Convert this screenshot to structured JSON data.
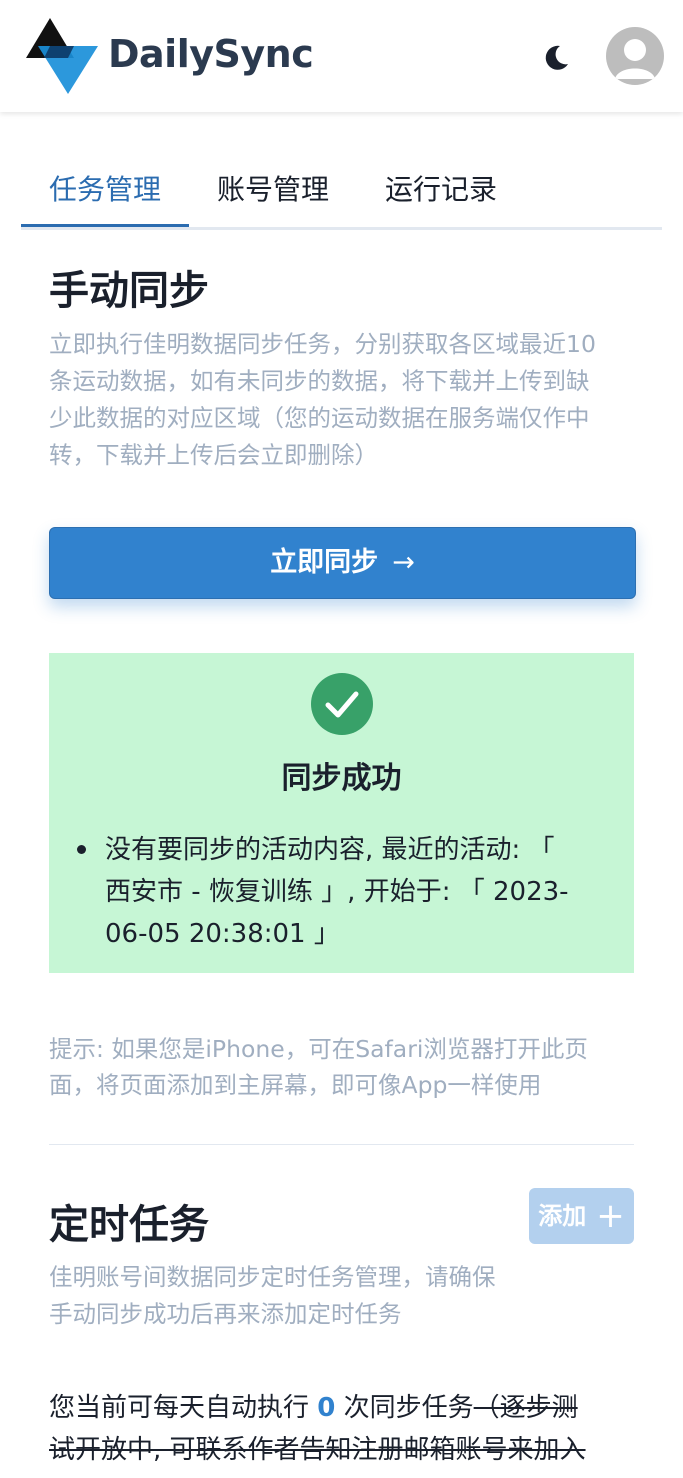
{
  "header": {
    "brand": "DailySync",
    "theme_icon": "moon-icon",
    "avatar_icon": "user-avatar-icon"
  },
  "tabs": [
    {
      "label": "任务管理",
      "active": true
    },
    {
      "label": "账号管理",
      "active": false
    },
    {
      "label": "运行记录",
      "active": false
    }
  ],
  "manual": {
    "title": "手动同步",
    "desc_lines": [
      "立即执行佳明数据同步任务，分别获取各区域最近10",
      "条运动数据，如有未同步的数据，将下载并上传到缺",
      "少此数据的对应区域（您的运动数据在服务端仅作中",
      "转，下载并上传后会立即删除）"
    ],
    "button_label": "立即同步",
    "button_arrow": "→"
  },
  "alert": {
    "title": "同步成功",
    "lines": [
      "没有要同步的活动内容, 最近的活动: 「",
      "西安市 - 恢复训练 」, 开始于: 「 2023-",
      "06-05 20:38:01 」"
    ]
  },
  "tip": {
    "lines": [
      "提示: 如果您是iPhone，可在Safari浏览器打开此页",
      "面，将页面添加到主屏幕，即可像App一样使用"
    ]
  },
  "scheduled": {
    "title": "定时任务",
    "add_label": "添加",
    "add_plus": "+",
    "desc_lines": [
      "佳明账号间数据同步定时任务管理，请确保",
      "手动同步成功后再来添加定时任务"
    ],
    "quota_prefix": "您当前可每天自动执行 ",
    "quota_count": "0",
    "quota_suffix": " 次同步任务",
    "quota_strike_1": "（逐步测",
    "quota_strike_2": "试开放中, 可联系作者告知注册邮箱账号来加入"
  },
  "colors": {
    "accent": "#3182ce",
    "success_bg": "#c6f6d5",
    "success_icon": "#38a169",
    "muted_text": "#a0aec0"
  }
}
